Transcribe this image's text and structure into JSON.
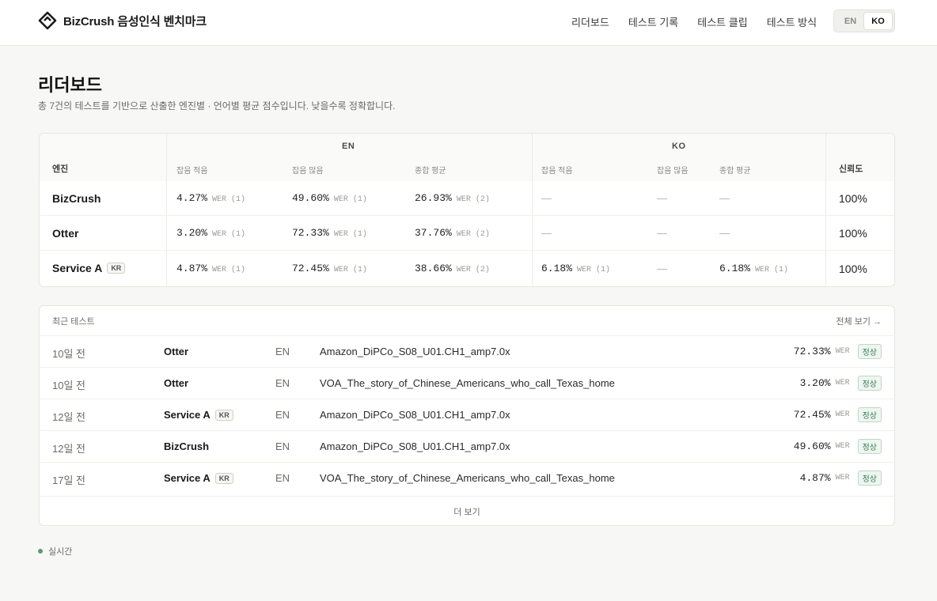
{
  "header": {
    "brand": "BizCrush 음성인식 벤치마크",
    "nav": [
      "리더보드",
      "테스트 기록",
      "테스트 클립",
      "테스트 방식"
    ],
    "lang": [
      "EN",
      "KO"
    ],
    "lang_active": "KO"
  },
  "page": {
    "title": "리더보드",
    "subtitle": "총 7건의 테스트를 기반으로 산출한 엔진별 · 언어별 평균 점수입니다. 낮을수록 정확합니다."
  },
  "leaderboard": {
    "col_engine": "엔진",
    "group_en": "EN",
    "group_ko": "KO",
    "sub_low": "잡음 적음",
    "sub_high": "잡음 많음",
    "sub_avg": "종합 평균",
    "col_reliability": "신뢰도",
    "dash": "—",
    "rows": [
      {
        "engine": "BizCrush",
        "badge": "",
        "en_low": "4.27%",
        "en_low_wer": "WER (1)",
        "en_high": "49.60%",
        "en_high_wer": "WER (1)",
        "en_avg": "26.93%",
        "en_avg_wer": "WER (2)",
        "ko_low": "",
        "ko_low_wer": "",
        "ko_avg": "",
        "ko_avg_wer": "",
        "reliability": "100%"
      },
      {
        "engine": "Otter",
        "badge": "",
        "en_low": "3.20%",
        "en_low_wer": "WER (1)",
        "en_high": "72.33%",
        "en_high_wer": "WER (1)",
        "en_avg": "37.76%",
        "en_avg_wer": "WER (2)",
        "ko_low": "",
        "ko_low_wer": "",
        "ko_avg": "",
        "ko_avg_wer": "",
        "reliability": "100%"
      },
      {
        "engine": "Service A",
        "badge": "KR",
        "en_low": "4.87%",
        "en_low_wer": "WER (1)",
        "en_high": "72.45%",
        "en_high_wer": "WER (1)",
        "en_avg": "38.66%",
        "en_avg_wer": "WER (2)",
        "ko_low": "6.18%",
        "ko_low_wer": "WER (1)",
        "ko_avg": "6.18%",
        "ko_avg_wer": "WER (1)",
        "reliability": "100%"
      }
    ]
  },
  "recent": {
    "title": "최근 테스트",
    "view_all": "전체 보기 →",
    "more": "더 보기",
    "wer": "WER",
    "rows": [
      {
        "time": "10일 전",
        "engine": "Otter",
        "badge": "",
        "lang": "EN",
        "file": "Amazon_DiPCo_S08_U01.CH1_amp7.0x",
        "score": "72.33%",
        "status": "정상"
      },
      {
        "time": "10일 전",
        "engine": "Otter",
        "badge": "",
        "lang": "EN",
        "file": "VOA_The_story_of_Chinese_Americans_who_call_Texas_home",
        "score": "3.20%",
        "status": "정상"
      },
      {
        "time": "12일 전",
        "engine": "Service A",
        "badge": "KR",
        "lang": "EN",
        "file": "Amazon_DiPCo_S08_U01.CH1_amp7.0x",
        "score": "72.45%",
        "status": "정상"
      },
      {
        "time": "12일 전",
        "engine": "BizCrush",
        "badge": "",
        "lang": "EN",
        "file": "Amazon_DiPCo_S08_U01.CH1_amp7.0x",
        "score": "49.60%",
        "status": "정상"
      },
      {
        "time": "17일 전",
        "engine": "Service A",
        "badge": "KR",
        "lang": "EN",
        "file": "VOA_The_story_of_Chinese_Americans_who_call_Texas_home",
        "score": "4.87%",
        "status": "정상"
      }
    ]
  },
  "footer": {
    "live": "실시간"
  },
  "colors": {
    "accent": "#5b9a6e",
    "status_bg": "#eef6f0"
  },
  "icons": {
    "brand": "diamond-logo-icon",
    "live": "live-dot-icon"
  }
}
